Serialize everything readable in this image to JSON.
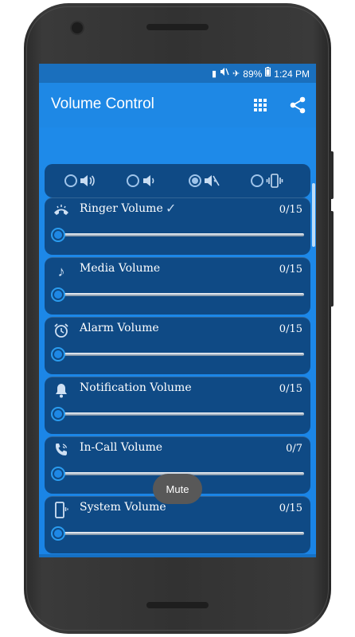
{
  "status": {
    "battery": "89%",
    "time": "1:24 PM",
    "icons": [
      "battery-alert-icon",
      "mute-icon",
      "airplane-icon",
      "battery-icon"
    ]
  },
  "app": {
    "title": "Volume Control",
    "actions": [
      "grid-icon",
      "share-icon"
    ]
  },
  "modes": [
    {
      "name": "sound-mode",
      "icon": "speaker-loud-icon",
      "selected": false
    },
    {
      "name": "quiet-mode",
      "icon": "speaker-quiet-icon",
      "selected": false
    },
    {
      "name": "mute-mode",
      "icon": "speaker-mute-icon",
      "selected": true
    },
    {
      "name": "vibrate-mode",
      "icon": "vibrate-icon",
      "selected": false
    }
  ],
  "volumes": [
    {
      "label": "Ringer Volume",
      "value": "0/15",
      "icon": "ringer-phone-icon",
      "checked": true
    },
    {
      "label": "Media Volume",
      "value": "0/15",
      "icon": "music-note-icon",
      "checked": false
    },
    {
      "label": "Alarm Volume",
      "value": "0/15",
      "icon": "alarm-clock-icon",
      "checked": false
    },
    {
      "label": "Notification Volume",
      "value": "0/15",
      "icon": "bell-icon",
      "checked": false
    },
    {
      "label": "In-Call Volume",
      "value": "0/7",
      "icon": "in-call-phone-icon",
      "checked": false
    },
    {
      "label": "System Volume",
      "value": "0/15",
      "icon": "phone-system-icon",
      "checked": false
    }
  ],
  "toast": {
    "text": "Mute"
  },
  "colors": {
    "primary": "#1e88e5",
    "status_bar": "#1a6fbd",
    "card": "#0f4a85",
    "accent": "#2a9cf0"
  }
}
